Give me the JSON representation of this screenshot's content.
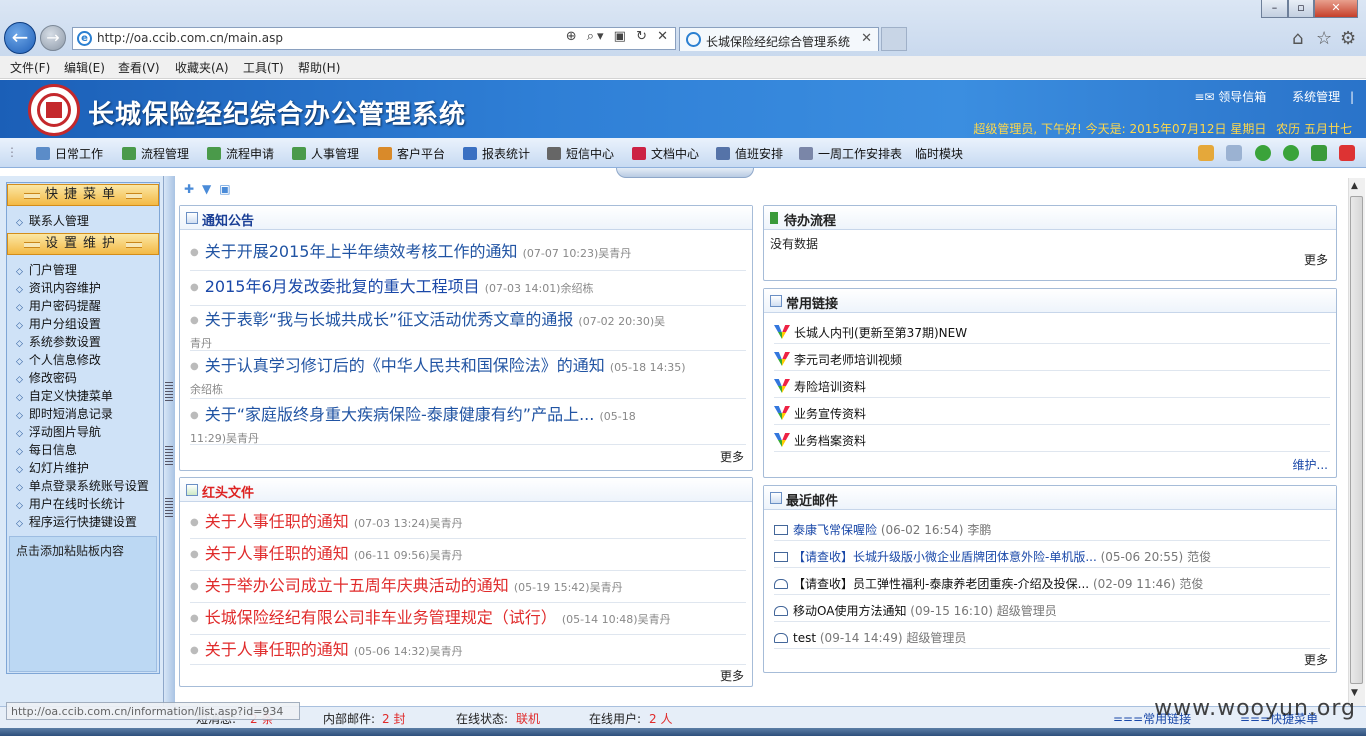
{
  "browser": {
    "url": "http://oa.ccib.com.cn/main.asp",
    "tab_title": "长城保险经纪综合管理系统",
    "menu": [
      "文件(F)",
      "编辑(E)",
      "查看(V)",
      "收藏夹(A)",
      "工具(T)",
      "帮助(H)"
    ]
  },
  "header": {
    "title": "长城保险经纪综合办公管理系统",
    "links": [
      "领导信箱",
      "系统管理"
    ],
    "welcome": "超级管理员, 下午好! 今天是: 2015年07月12日 星期日",
    "lunar": "农历 五月廿七"
  },
  "nav": {
    "items": [
      "日常工作",
      "流程管理",
      "流程申请",
      "人事管理",
      "客户平台",
      "报表统计",
      "短信中心",
      "文档中心",
      "值班安排",
      "一周工作安排表",
      "临时模块"
    ]
  },
  "sidebar": {
    "quick_title": "快捷菜单",
    "quick_items": [
      "联系人管理"
    ],
    "settings_title": "设置维护",
    "settings_items": [
      "门户管理",
      "资讯内容维护",
      "用户密码提醒",
      "用户分组设置",
      "系统参数设置",
      "个人信息修改",
      "修改密码",
      "自定义快捷菜单",
      "即时短消息记录",
      "浮动图片导航",
      "每日信息",
      "幻灯片维护",
      "单点登录系统账号设置",
      "用户在线时长统计",
      "程序运行快捷键设置"
    ],
    "clipboard": "点击添加粘贴板内容"
  },
  "notices": {
    "title": "通知公告",
    "items": [
      {
        "title": "关于开展2015年上半年绩效考核工作的通知",
        "meta": "(07-07 10:23)吴青丹"
      },
      {
        "title": "2015年6月发改委批复的重大工程项目",
        "meta": "(07-03 14:01)余绍栋"
      },
      {
        "title": "关于表彰“我与长城共成长”征文活动优秀文章的通报",
        "meta": "(07-02 20:30)吴",
        "meta2": "青丹"
      },
      {
        "title": "关于认真学习修订后的《中华人民共和国保险法》的通知",
        "meta": "(05-18 14:35)",
        "meta2": "余绍栋"
      },
      {
        "title": "关于“家庭版终身重大疾病保险-泰康健康有约”产品上...",
        "meta": "(05-18",
        "meta2": "11:29)吴青丹"
      }
    ],
    "more": "更多"
  },
  "redfiles": {
    "title": "红头文件",
    "items": [
      {
        "title": "关于人事任职的通知",
        "meta": "(07-03 13:24)吴青丹"
      },
      {
        "title": "关于人事任职的通知",
        "meta": "(06-11 09:56)吴青丹"
      },
      {
        "title": "关于举办公司成立十五周年庆典活动的通知",
        "meta": "(05-19 15:42)吴青丹"
      },
      {
        "title": "长城保险经纪有限公司非车业务管理规定（试行）",
        "meta": "(05-14 10:48)吴青丹"
      },
      {
        "title": "关于人事任职的通知",
        "meta": "(05-06 14:32)吴青丹"
      }
    ],
    "more": "更多"
  },
  "pending": {
    "title": "待办流程",
    "empty": "没有数据",
    "more": "更多"
  },
  "links": {
    "title": "常用链接",
    "items": [
      "长城人内刊(更新至第37期)NEW",
      "李元司老师培训视频",
      "寿险培训资料",
      "业务宣传资料",
      "业务档案资料"
    ],
    "maintain": "维护..."
  },
  "mail": {
    "title": "最近邮件",
    "items": [
      {
        "subject": "泰康飞常保喔险",
        "meta": "(06-02 16:54)",
        "sender": "李鹏",
        "link": true,
        "icon": "closed"
      },
      {
        "subject": "【请查收】长城升级版小微企业盾牌团体意外险-单机版...",
        "meta": "(05-06 20:55)",
        "sender": "范俊",
        "link": true,
        "icon": "closed"
      },
      {
        "subject": "【请查收】员工弹性福利-泰康养老团重疾-介绍及投保...",
        "meta": "(02-09 11:46)",
        "sender": "范俊",
        "link": false,
        "icon": "open"
      },
      {
        "subject": "移动OA使用方法通知",
        "meta": "(09-15 16:10)",
        "sender": "超级管理员",
        "link": false,
        "icon": "open"
      },
      {
        "subject": "test",
        "meta": "(09-14 14:49)",
        "sender": "超级管理员",
        "link": false,
        "icon": "open"
      }
    ],
    "more": "更多"
  },
  "status": {
    "tooltip_url": "http://oa.ccib.com.cn/information/list.asp?id=934",
    "sms_label": "短消息:",
    "sms_count": "2 条",
    "inner_mail_label": "内部邮件:",
    "inner_mail_count": "2 封",
    "online_state_label": "在线状态:",
    "online_state": "联机",
    "online_users_label": "在线用户:",
    "online_users": "2 人",
    "links_label": "===常用链接",
    "quick_label": "===快捷菜单"
  },
  "watermark": "www.wooyun.org",
  "colors": {
    "accent": "#2154a3",
    "red": "#e02b2b",
    "banner": "#2f7fd6",
    "gold": "#ffd84a"
  }
}
